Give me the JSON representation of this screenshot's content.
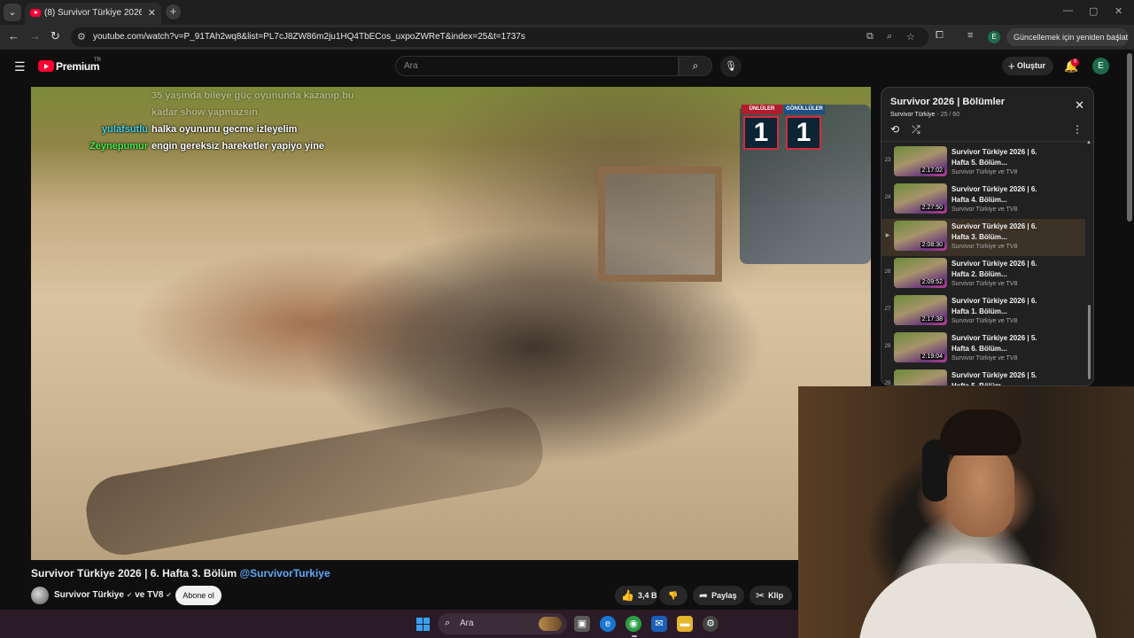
{
  "browser": {
    "tab_title": "(8) Survivor Türkiye 2026 | 6. Hafta 3. Bölüm",
    "url": "youtube.com/watch?v=P_91TAh2wq8&list=PL7cJ8ZW86m2ju1HQ4TbECos_uxpoZWReT&index=25&t=1737s",
    "update_button": "Güncellemek için yeniden başlat",
    "profile_initial": "E"
  },
  "masthead": {
    "brand": "Premium",
    "region": "TR",
    "search_placeholder": "Ara",
    "create_label": "Oluştur",
    "notification_count": "9",
    "avatar_initial": "E"
  },
  "player": {
    "scoreboard": {
      "left_team": "ÜNLÜLER",
      "right_team": "GÖNÜLLÜLER",
      "left_score": "1",
      "right_score": "1"
    },
    "chat": [
      {
        "user": "",
        "message": "35 yaşında bileye güç oyununda kazanıp bu",
        "faded": true
      },
      {
        "user": "",
        "message": "kadar show yapmazsın",
        "faded": true
      },
      {
        "user": "yulafsutlu",
        "message": "halka oyununu gecme izleyelim",
        "faded": false
      },
      {
        "user": "Zeynepumur",
        "message": "engin gereksiz hareketler yapiyo yine",
        "faded": false
      }
    ]
  },
  "video": {
    "title": "Survivor Türkiye 2026 | 6. Hafta 3. Bölüm",
    "mention": "@SurvivorTurkiye",
    "channel": "Survivor Türkiye",
    "collab_joiner": "ve",
    "collab_channel": "TV8",
    "subscribe_label": "Abone ol",
    "likes": "3,4 B",
    "share_label": "Paylaş",
    "clip_label": "Klip"
  },
  "playlist": {
    "title": "Survivor 2026 | Bölümler",
    "channel": "Survivor Türkiye",
    "position": "25 / 60",
    "items": [
      {
        "index": "23",
        "title": "Survivor Türkiye 2026 | 6. Hafta 5. Bölüm...",
        "duration": "2:17:02",
        "channel": "Survivor Türkiye ve TV8",
        "current": false
      },
      {
        "index": "24",
        "title": "Survivor Türkiye 2026 | 6. Hafta 4. Bölüm...",
        "duration": "2:27:50",
        "channel": "Survivor Türkiye ve TV8",
        "current": false
      },
      {
        "index": "▶",
        "title": "Survivor Türkiye 2026 | 6. Hafta 3. Bölüm...",
        "duration": "2:08:30",
        "channel": "Survivor Türkiye ve TV8",
        "current": true
      },
      {
        "index": "26",
        "title": "Survivor Türkiye 2026 | 6. Hafta 2. Bölüm...",
        "duration": "2:09:52",
        "channel": "Survivor Türkiye ve TV8",
        "current": false
      },
      {
        "index": "27",
        "title": "Survivor Türkiye 2026 | 6. Hafta 1. Bölüm...",
        "duration": "2:17:38",
        "channel": "Survivor Türkiye ve TV8",
        "current": false
      },
      {
        "index": "28",
        "title": "Survivor Türkiye 2026 | 5. Hafta 6. Bölüm...",
        "duration": "2:19:04",
        "channel": "Survivor Türkiye ve TV8",
        "current": false
      },
      {
        "index": "29",
        "title": "Survivor Türkiye 2026 | 5. Hafta 5. Bölüm...",
        "duration": "",
        "channel": "",
        "current": false
      }
    ]
  },
  "taskbar": {
    "search_placeholder": "Ara"
  },
  "colors": {
    "youtube_red": "#ff0033",
    "link_blue": "#5fa8f5",
    "current_item_bg": "#3b3126",
    "chat_user_cyan": "#44d6ec",
    "chat_user_green": "#4af04a"
  },
  "icons": {
    "tab_favicon": "youtube-icon",
    "search": "search-icon",
    "mic": "mic-icon",
    "bell": "bell-icon",
    "like": "thumbs-up-icon",
    "dislike": "thumbs-down-icon",
    "share": "share-icon",
    "clip": "scissors-icon",
    "loop": "loop-icon",
    "shuffle": "shuffle-icon"
  }
}
